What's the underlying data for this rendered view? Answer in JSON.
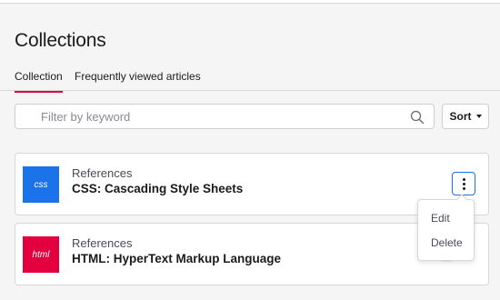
{
  "page": {
    "title": "Collections"
  },
  "tabs": [
    {
      "label": "Collection",
      "active": true
    },
    {
      "label": "Frequently viewed articles",
      "active": false
    }
  ],
  "search": {
    "placeholder": "Filter by keyword",
    "value": ""
  },
  "sort": {
    "label": "Sort"
  },
  "collections": [
    {
      "thumb_label": "css",
      "thumb_color": "#1a73e8",
      "tag": "References",
      "name": "CSS: Cascading Style Sheets"
    },
    {
      "thumb_label": "html",
      "thumb_color": "#e2003f",
      "tag": "References",
      "name": "HTML: HyperText Markup Language"
    }
  ],
  "context_menu": {
    "items": [
      "Edit",
      "Delete"
    ],
    "hovered": "Delete"
  },
  "colors": {
    "accent": "#e2003f",
    "focus_blue": "#1a73e8"
  },
  "icons": {
    "search": "magnifier-icon",
    "more": "vertical-ellipsis-icon",
    "sort": "caret-down-icon"
  }
}
